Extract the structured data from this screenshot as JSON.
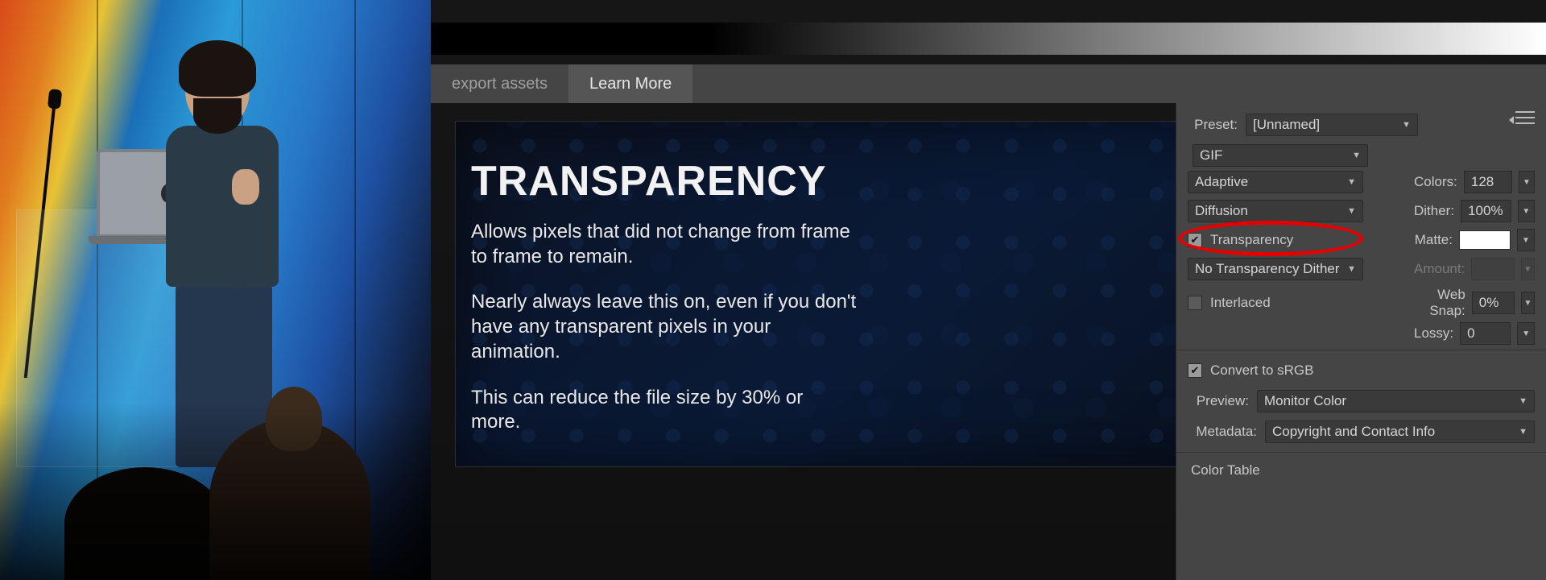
{
  "slide": {
    "title": "TRANSPARENCY",
    "p1": "Allows pixels that did not change from frame to frame to remain.",
    "p2": "Nearly always leave this on, even if you don't have any transparent pixels in your animation.",
    "p3": "This can reduce the file size by 30% or more."
  },
  "tabs": {
    "export_assets": "export assets",
    "learn_more": "Learn More"
  },
  "panel": {
    "preset_label": "Preset:",
    "preset_value": "[Unnamed]",
    "format": "GIF",
    "reduction": "Adaptive",
    "colors_label": "Colors:",
    "colors_value": "128",
    "dither_algo": "Diffusion",
    "dither_label": "Dither:",
    "dither_value": "100%",
    "transparency_label": "Transparency",
    "matte_label": "Matte:",
    "trans_dither": "No Transparency Dither",
    "amount_label": "Amount:",
    "interlaced_label": "Interlaced",
    "websnap_label": "Web Snap:",
    "websnap_value": "0%",
    "lossy_label": "Lossy:",
    "lossy_value": "0",
    "convert_srgb": "Convert to sRGB",
    "preview_label": "Preview:",
    "preview_value": "Monitor Color",
    "metadata_label": "Metadata:",
    "metadata_value": "Copyright and Contact Info",
    "color_table": "Color Table"
  }
}
